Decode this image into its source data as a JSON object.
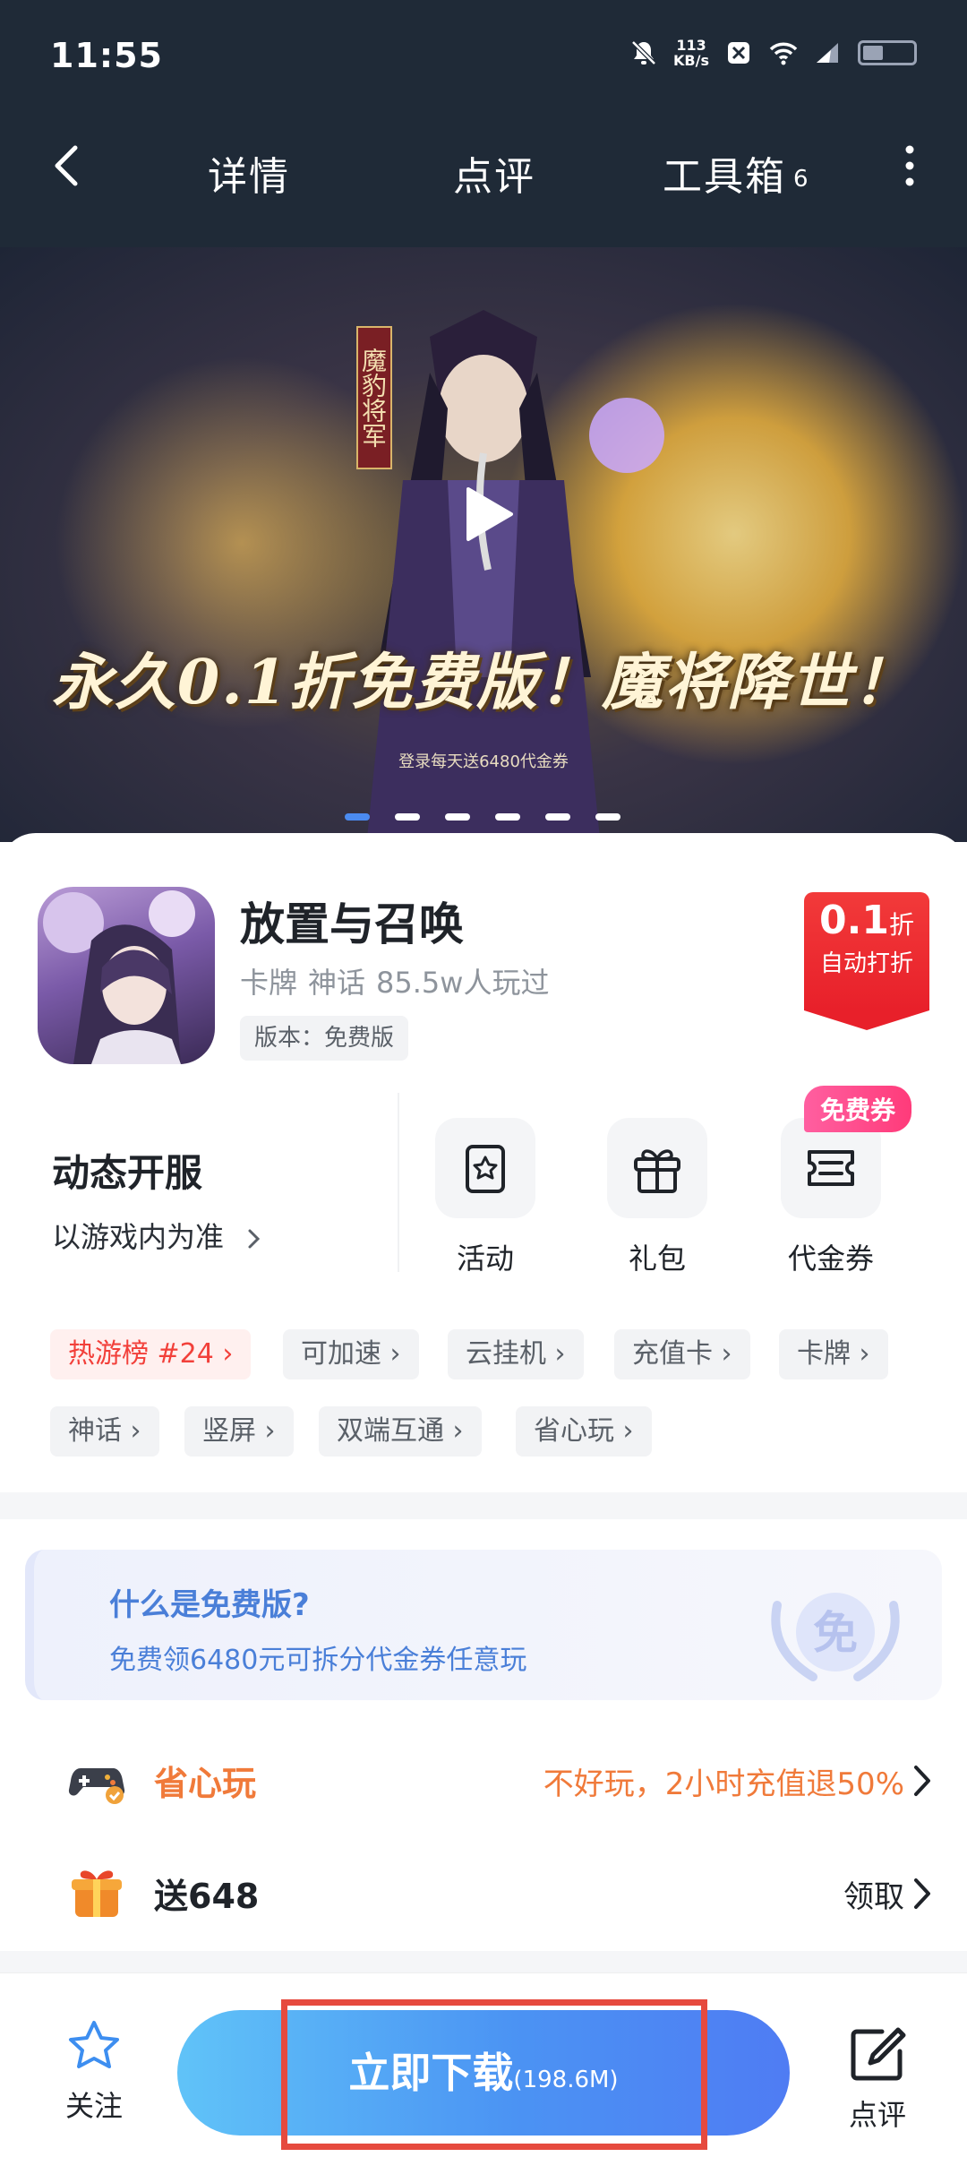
{
  "status_bar": {
    "time": "11:55",
    "netspeed_value": "113",
    "netspeed_unit": "KB/s"
  },
  "nav": {
    "tabs": [
      {
        "label": "详情"
      },
      {
        "label": "点评"
      },
      {
        "label": "工具箱",
        "badge": "6"
      }
    ]
  },
  "banner": {
    "caption": "永久0.1折免费版！魔将降世！",
    "subcaption": "登录每天送6480代金券",
    "tag": "魔豹将军",
    "slide_count": 6,
    "active_slide": 1
  },
  "app": {
    "name": "放置与召唤",
    "tags": [
      "卡牌",
      "神话"
    ],
    "players": "85.5w人玩过",
    "version": "版本：免费版",
    "discount": {
      "value": "0.1",
      "unit": "折",
      "label": "自动打折"
    }
  },
  "server": {
    "title": "动态开服",
    "subtitle": "以游戏内为准"
  },
  "services": [
    {
      "label": "活动",
      "icon": "activity-icon"
    },
    {
      "label": "礼包",
      "icon": "gift-icon"
    },
    {
      "label": "代金券",
      "icon": "coupon-icon",
      "badge": "免费券"
    }
  ],
  "tags": [
    "热游榜 #24",
    "可加速",
    "云挂机",
    "充值卡",
    "卡牌",
    "神话",
    "竖屏",
    "双端互通",
    "省心玩"
  ],
  "free_info": {
    "title": "什么是免费版?",
    "desc": "免费领6480元可拆分代金券任意玩",
    "emblem": "免"
  },
  "rows": [
    {
      "label": "省心玩",
      "right": "不好玩，2小时充值退50%",
      "icon": "gamepad-icon"
    },
    {
      "label": "送648",
      "right": "领取",
      "icon": "gift-box-icon"
    }
  ],
  "bottom": {
    "follow": "关注",
    "download": "立即下载",
    "download_size": "(198.6M)",
    "review": "点评"
  },
  "colors": {
    "accent": "#4b8bf0",
    "hot": "#f2403a",
    "orange": "#f07a3a",
    "discount": "#e8202a",
    "highlight": "#e64a3e"
  }
}
